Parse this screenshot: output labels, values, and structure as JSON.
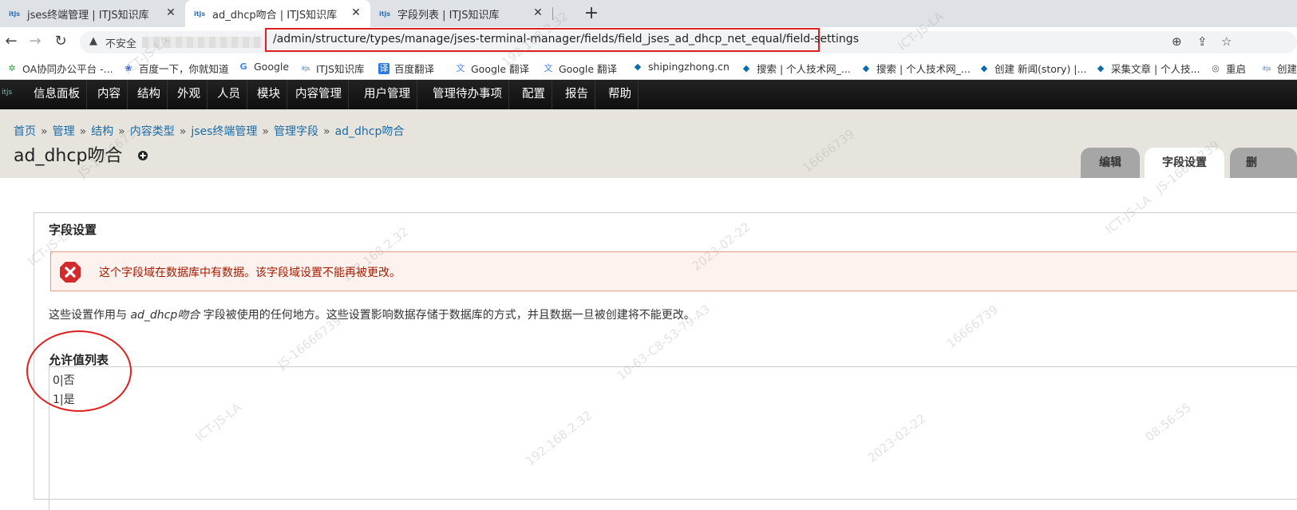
{
  "tabs": [
    {
      "title": "jses终端管理 | ITJS知识库",
      "favicon": "itjs-favicon",
      "active": false
    },
    {
      "title": "ad_dhcp吻合 | ITJS知识库",
      "favicon": "itjs-favicon",
      "active": true
    },
    {
      "title": "字段列表 | ITJS知识库",
      "favicon": "itjs-favicon",
      "active": false
    }
  ],
  "favicon_text": "itjs",
  "address_bar": {
    "security_label": "不安全",
    "url_path": "/admin/structure/types/manage/jses-terminal-manager/fields/field_jses_ad_dhcp_net_equal/field-settings"
  },
  "bookmarks": [
    {
      "label": "OA协同办公平台 -...",
      "icon": "oa-icon"
    },
    {
      "label": "百度一下，你就知道",
      "icon": "baidu-icon"
    },
    {
      "label": "Google",
      "icon": "google-icon"
    },
    {
      "label": "ITJS知识库",
      "icon": "itjs-icon"
    },
    {
      "label": "百度翻译",
      "icon": "baidu-translate-icon"
    },
    {
      "label": "Google 翻译",
      "icon": "google-translate-icon"
    },
    {
      "label": "Google 翻译",
      "icon": "google-translate-icon"
    },
    {
      "label": "shipingzhong.cn",
      "icon": "drupal-icon"
    },
    {
      "label": "搜索 | 个人技术网_...",
      "icon": "drupal-icon"
    },
    {
      "label": "搜索 | 个人技术网_...",
      "icon": "drupal-icon"
    },
    {
      "label": "创建 新闻(story) |...",
      "icon": "drupal-icon"
    },
    {
      "label": "采集文章 | 个人技...",
      "icon": "drupal-icon"
    },
    {
      "label": "重启",
      "icon": "globe-icon"
    },
    {
      "label": "创建",
      "icon": "itjs-icon"
    }
  ],
  "toolbar": {
    "items": [
      "信息面板",
      "内容",
      "结构",
      "外观",
      "人员",
      "模块",
      "内容管理",
      "用户管理",
      "管理待办事项",
      "配置",
      "报告",
      "帮助"
    ]
  },
  "breadcrumb": [
    "首页",
    "管理",
    "结构",
    "内容类型",
    "jses终端管理",
    "管理字段",
    "ad_dhcp吻合"
  ],
  "breadcrumb_separator": "»",
  "page_title": "ad_dhcp吻合",
  "page_tabs": [
    {
      "label": "编辑",
      "active": false
    },
    {
      "label": "字段设置",
      "active": true
    },
    {
      "label": "删",
      "active": false
    }
  ],
  "fieldset_legend": "字段设置",
  "error_message": "这个字段域在数据库中有数据。该字段域设置不能再被更改。",
  "description": {
    "before": "这些设置作用与 ",
    "field_name": "ad_dhcp吻合",
    "after": " 字段被使用的任何地方。这些设置影响数据存储于数据库的方式，并且数据一旦被创建将不能更改。"
  },
  "allowed_values": {
    "label": "允许值列表",
    "lines": [
      "0|否",
      "1|是"
    ]
  },
  "watermark": [
    "ICT-JS-LA",
    "JS-16666739",
    "192.168.2.32",
    "10-63-C8-53-79-A3",
    "2023-02-22",
    "08:56:55",
    "16666739"
  ],
  "colors": {
    "annotation_red": "#e02020",
    "link_blue": "#1a6aa8",
    "error_text": "#a51b00",
    "error_bg": "#fdf2ee",
    "toolbar_bg": "#0f0f0f",
    "header_bg": "#e7e4dd"
  }
}
